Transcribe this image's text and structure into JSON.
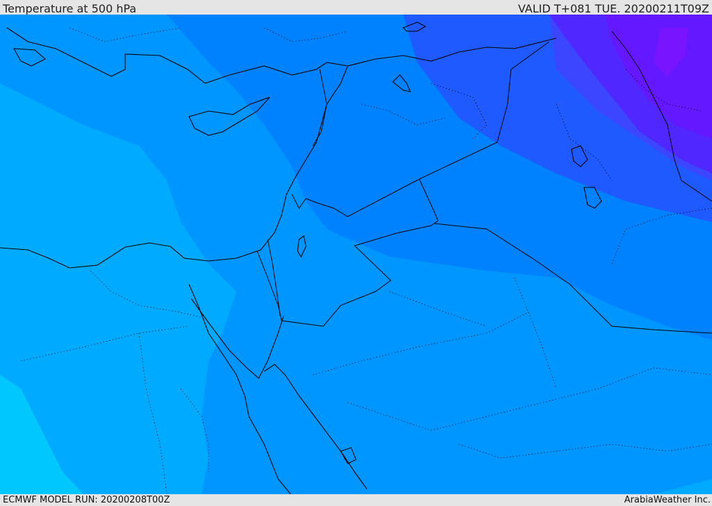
{
  "header": {
    "title": "Temperature at 500 hPa",
    "valid": "VALID T+081 TUE. 20200211T09Z"
  },
  "footer": {
    "model_run": "ECMWF MODEL RUN: 20200208T00Z",
    "credit": "ArabiaWeather Inc."
  },
  "map": {
    "field": "Temperature at 500 hPa",
    "shading_colors": [
      "#00c8ff",
      "#00aaff",
      "#0096ff",
      "#0082ff",
      "#0073ff",
      "#1e5aff",
      "#3c46ff",
      "#5028ff",
      "#7814ff"
    ],
    "border_color": "#000000"
  }
}
